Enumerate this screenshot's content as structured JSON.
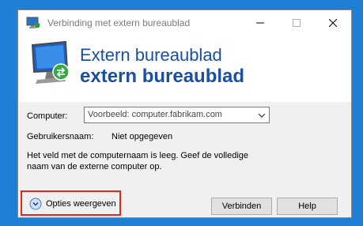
{
  "window": {
    "title": "Verbinding met extern bureaublad"
  },
  "banner": {
    "line1": "Extern bureaublad",
    "line2": "extern bureaublad"
  },
  "form": {
    "computer_label": "Computer:",
    "computer_placeholder": "Voorbeeld: computer.fabrikam.com",
    "username_label": "Gebruikersnaam:",
    "username_value": "Niet opgegeven",
    "message": "Het veld met de computernaam is leeg. Geef de volledige naam van de externe computer op."
  },
  "footer": {
    "options_label": "Opties weergeven",
    "connect_label": "Verbinden",
    "help_label": "Help"
  },
  "icons": {
    "app": "remote-desktop-icon",
    "banner": "remote-desktop-monitor-icon",
    "options": "chevron-down-circle-icon",
    "combo": "chevron-down-icon"
  },
  "colors": {
    "desktop": "#1f7fd4",
    "banner_text": "#1b4fa0",
    "highlight": "#e0281e"
  }
}
